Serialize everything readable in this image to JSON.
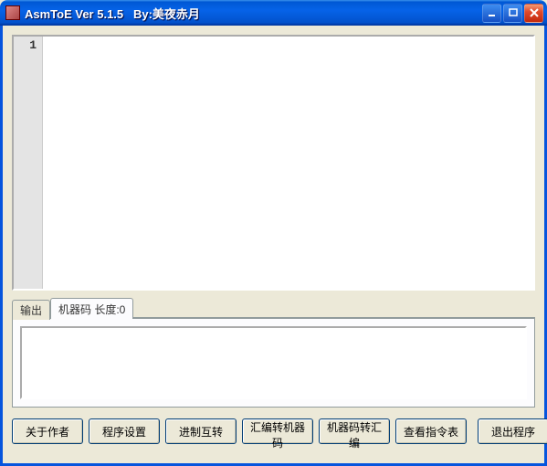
{
  "window": {
    "title": "AsmToE Ver 5.1.5   By:美夜赤月"
  },
  "editor": {
    "line_number": "1",
    "content": ""
  },
  "tabs": {
    "output_label": "输出",
    "machinecode_label": "机器码 长度:0"
  },
  "buttons": {
    "about": "关于作者",
    "settings": "程序设置",
    "radix": "进制互转",
    "asm2mc": "汇编转机器码",
    "mc2asm": "机器码转汇编",
    "instr_table": "查看指令表",
    "exit": "退出程序"
  }
}
